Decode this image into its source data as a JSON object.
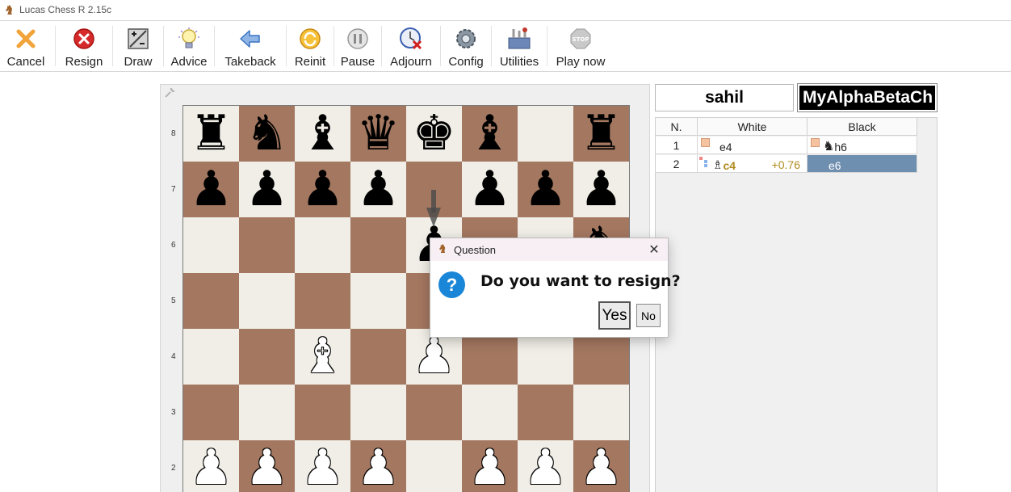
{
  "window": {
    "title": "Lucas Chess R 2.15c"
  },
  "toolbar": {
    "items": [
      {
        "label": "Cancel",
        "icon": "cancel-icon"
      },
      {
        "label": "Resign",
        "icon": "resign-icon"
      },
      {
        "label": "Draw",
        "icon": "draw-icon"
      },
      {
        "label": "Advice",
        "icon": "advice-icon"
      },
      {
        "label": "Takeback",
        "icon": "takeback-icon"
      },
      {
        "label": "Reinit",
        "icon": "reinit-icon"
      },
      {
        "label": "Pause",
        "icon": "pause-icon"
      },
      {
        "label": "Adjourn",
        "icon": "adjourn-icon"
      },
      {
        "label": "Config",
        "icon": "config-icon"
      },
      {
        "label": "Utilities",
        "icon": "utilities-icon"
      },
      {
        "label": "Play now",
        "icon": "stop-icon"
      }
    ]
  },
  "board": {
    "colors": {
      "light": "#f0eee6",
      "dark": "#a37760"
    },
    "ranks": [
      "8",
      "7",
      "6",
      "5",
      "4",
      "3",
      "2"
    ],
    "rows": [
      [
        "r",
        "n",
        "b",
        "q",
        "k",
        "b",
        "",
        "r"
      ],
      [
        "p",
        "p",
        "p",
        "p",
        "",
        "p",
        "p",
        "p"
      ],
      [
        "",
        "",
        "",
        "",
        "p",
        "",
        "",
        "n"
      ],
      [
        "",
        "",
        "",
        "",
        "",
        "",
        "",
        ""
      ],
      [
        "",
        "",
        "B",
        "",
        "P",
        "",
        "",
        ""
      ],
      [
        "",
        "",
        "",
        "",
        "",
        "",
        "",
        ""
      ],
      [
        "P",
        "P",
        "P",
        "P",
        "",
        "P",
        "P",
        "P"
      ]
    ]
  },
  "players": {
    "white": "sahil",
    "black": "MyAlphaBetaCh"
  },
  "moves": {
    "headers": {
      "num": "N.",
      "white": "White",
      "black": "Black"
    },
    "rows": [
      {
        "num": "1",
        "white": "e4",
        "black": "h6",
        "black_piece": "♞"
      },
      {
        "num": "2",
        "white_piece": "♗",
        "white": "c4",
        "eval": "+0.76",
        "black": "e6",
        "selected": true
      }
    ]
  },
  "dialog": {
    "title": "Question",
    "message": "Do you want to resign?",
    "yes": "Yes",
    "no": "No",
    "close": "✕",
    "question_icon": "?"
  },
  "icons": {
    "app": "♞",
    "wrench": "🔧"
  }
}
